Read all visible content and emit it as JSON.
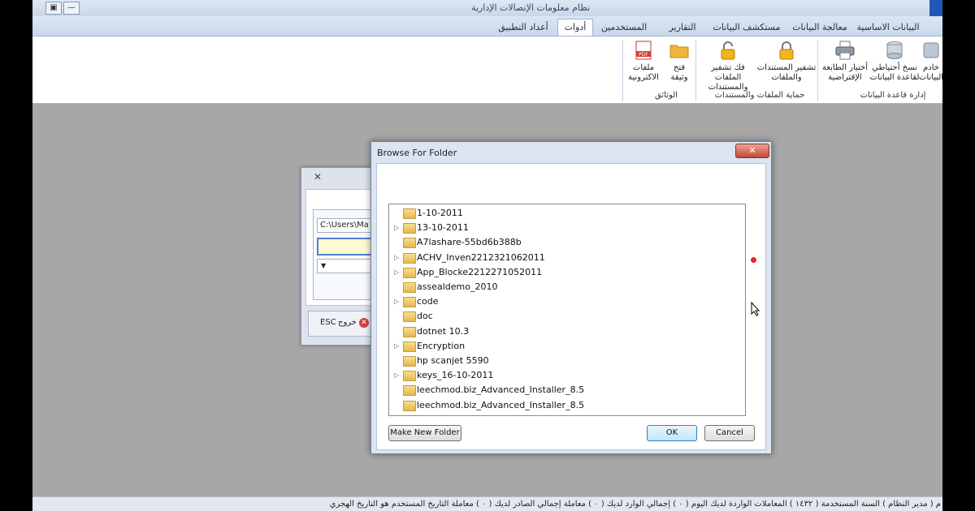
{
  "window": {
    "title": "نظام معلومات الإتصالات الإدارية",
    "controls": [
      "▣",
      "—"
    ]
  },
  "ribbon": {
    "tabs": [
      {
        "label": "البيانات الاساسية"
      },
      {
        "label": "معالجة البيانات"
      },
      {
        "label": "مستكشف البيانات"
      },
      {
        "label": "التقارير"
      },
      {
        "label": "المستخدمين"
      },
      {
        "label": "أدوات"
      },
      {
        "label": "أعداد التطبيق"
      }
    ],
    "buttons": {
      "backup": "نسخ أحتياطي\nلقاعدة البيانات",
      "printer": "أختيار الطابعة\nالإفتراضية",
      "decrypt": "فك تشفير الملفات\nوالمستندات",
      "encrypt": "تشفير المستندات\nوالملفات",
      "open_doc": "فتح\nوثيقة",
      "e_files": "ملفات\nالاكترونية",
      "server": "خادم\nالبيانات"
    },
    "groups": {
      "db_management": "إدارة قاعدة البيانات",
      "protection": "حماية الملفات والمستندات",
      "documents": "الوثائق"
    },
    "icons": {
      "backup": "database-icon",
      "printer": "printer-icon",
      "lock": "lock-icon",
      "folder": "folder-icon",
      "pdf": "pdf-icon"
    }
  },
  "bg_dialog": {
    "path_value": "C:\\Users\\Ma",
    "exit_label": "خروج",
    "exit_key": "ESC"
  },
  "browse_dialog": {
    "caption": "Browse For Folder",
    "folders": [
      {
        "name": "1-10-2011",
        "expandable": false
      },
      {
        "name": "13-10-2011",
        "expandable": true
      },
      {
        "name": "A7lashare-55bd6b388b",
        "expandable": false
      },
      {
        "name": "ACHV_Inven2212321062011",
        "expandable": true
      },
      {
        "name": "App_Blocke2212271052011",
        "expandable": true
      },
      {
        "name": "assealdemo_2010",
        "expandable": false
      },
      {
        "name": "code",
        "expandable": true
      },
      {
        "name": "doc",
        "expandable": false
      },
      {
        "name": "dotnet 10.3",
        "expandable": false
      },
      {
        "name": "Encryption",
        "expandable": true
      },
      {
        "name": "hp scanjet 5590",
        "expandable": false
      },
      {
        "name": "keys_16-10-2011",
        "expandable": true
      },
      {
        "name": "leechmod.biz_Advanced_Installer_8.5",
        "expandable": false
      },
      {
        "name": "leechmod.biz_Advanced_Installer_8.5",
        "expandable": false
      }
    ],
    "make_new_folder": "Make New Folder",
    "ok": "OK",
    "cancel": "Cancel",
    "scroll_position": 0.42
  },
  "status_bar": {
    "text": "م ( مدير النظام ) السنة المستخدمة ( ١٤٣٢ ) المعاملات الواردة لديك اليوم ( ٠ ) إجمالي الوارد لديك ( ٠ ) معاملة إجمالي الصادر لديك ( ٠ ) معاملة التاريخ المستخدم هو التاريخ الهجري"
  }
}
